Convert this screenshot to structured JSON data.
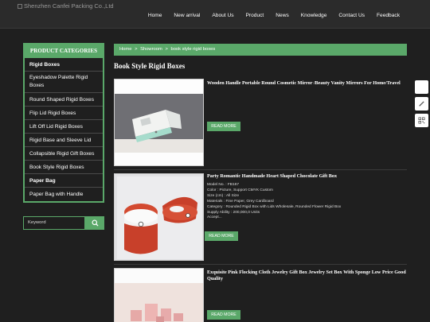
{
  "header": {
    "logo_alt": "Shenzhen Canfei Packing Co.,Ltd",
    "nav": [
      "Home",
      "New arrival",
      "About Us",
      "Product",
      "News",
      "Knowledge",
      "Contact Us",
      "Feedback"
    ]
  },
  "sidebar": {
    "title": "PRODUCT CATEGORIES",
    "items": [
      {
        "label": "Rigid Boxes"
      },
      {
        "label": "Eyeshadow Palette Rigid Boxes"
      },
      {
        "label": "Round Shaped Rigid Boxes"
      },
      {
        "label": "Flip Lid Rigid Boxes"
      },
      {
        "label": "Lift Off Lid Rigid Boxes"
      },
      {
        "label": "Rigid Base and Sleeve Lid"
      },
      {
        "label": "Collapsible Rigid Gift Boxes"
      },
      {
        "label": "Book Style Rigid Boxes"
      },
      {
        "label": "Paper Bag"
      },
      {
        "label": "Paper Bag with Handle"
      }
    ]
  },
  "search": {
    "placeholder": "Keyword"
  },
  "breadcrumb": [
    "Home",
    ">",
    "Showroom",
    ">",
    "book style rigid boxes"
  ],
  "page_title": "Book Style Rigid Boxes",
  "products": [
    {
      "title": "Wooden Handle Portable Round Cosmetic Mirror /Beauty Vanity Mirrors For Home/Travel",
      "button": "READ MORE"
    },
    {
      "title": "Party Romantic Handmade Heart Shaped Chocolate Gift Box",
      "specs": [
        "Model No. : FB167",
        "Color : Picture, Support CMYK Custom",
        "Size (cm) : All Size",
        "Materials : Fine Paper, Grey Cardboard",
        "Category : Rounded Rigid Box with Lids Wholesale, Rounded Flower Rigid Box",
        "Supply Ability : 200,000,0 Units",
        "Accept..."
      ],
      "button": "READ MORE"
    },
    {
      "title": "Exquisite Pink Flocking Cloth Jewelry Gift Box Jewelry Set Box With Sponge Low Price Good Quality",
      "button": "READ MORE"
    }
  ],
  "colors": {
    "accent": "#5aa869",
    "background": "#1f1f1f"
  },
  "floating_icons": [
    "message-icon",
    "edit-icon",
    "qr-code-icon"
  ]
}
